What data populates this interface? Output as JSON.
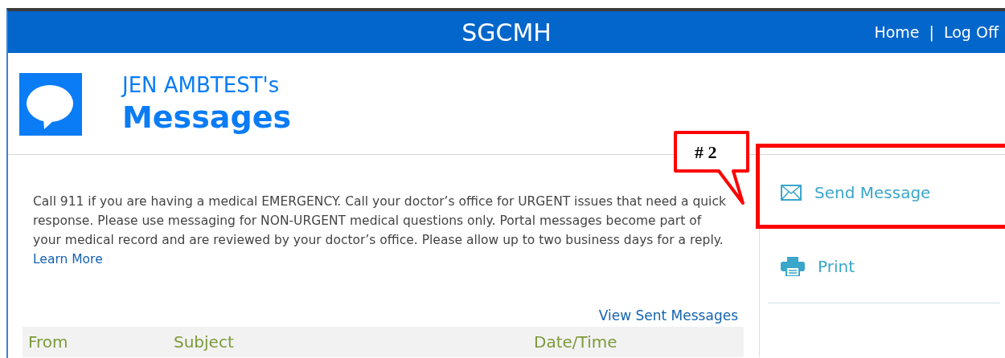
{
  "header": {
    "title": "SGCMH",
    "nav": [
      {
        "label": "Home"
      },
      {
        "label": "Log Off"
      }
    ],
    "separator": "|"
  },
  "page_header": {
    "owner": "JEN AMBTEST's",
    "title": "Messages"
  },
  "notice": {
    "text": "Call 911 if you are having a medical EMERGENCY. Call your doctor’s office for URGENT issues that need a quick response. Please use messaging for NON-URGENT medical questions only. Portal messages become part of your medical record and are reviewed by your doctor’s office. Please allow up to two business days for a reply.",
    "link": "Learn More"
  },
  "view_sent_link": "View Sent Messages",
  "table": {
    "columns": [
      "From",
      "Subject",
      "Date/Time"
    ]
  },
  "sidebar": {
    "actions": [
      {
        "kind": "send",
        "label": "Send Message",
        "highlighted": true
      },
      {
        "kind": "print",
        "label": "Print",
        "highlighted": false
      }
    ]
  },
  "annotation": {
    "label": "# 2"
  }
}
